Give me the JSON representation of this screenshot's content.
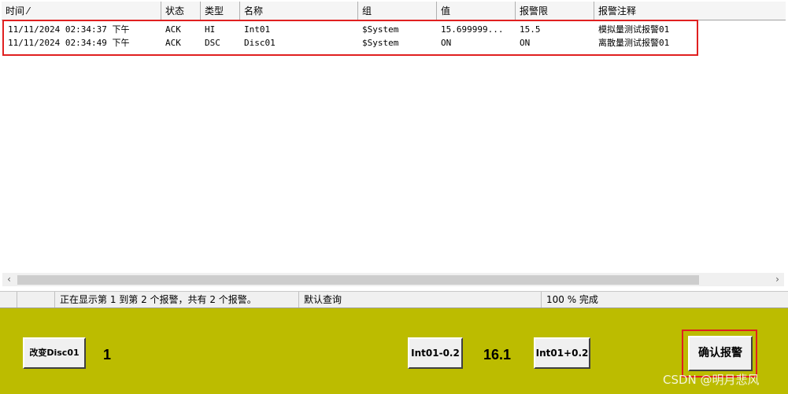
{
  "alarm_grid": {
    "columns": [
      "时间 ⁄",
      "状态",
      "类型",
      "名称",
      "组",
      "值",
      "报警限",
      "报警注释"
    ],
    "rows": [
      {
        "time": "11/11/2024 02:34:37 下午",
        "state": "ACK",
        "type": "HI",
        "name": "Int01",
        "group": "$System",
        "value": "15.699999...",
        "limit": "15.5",
        "comment": "模拟量测试报警01"
      },
      {
        "time": "11/11/2024 02:34:49 下午",
        "state": "ACK",
        "type": "DSC",
        "name": "Disc01",
        "group": "$System",
        "value": "ON",
        "limit": "ON",
        "comment": "离散量测试报警01"
      }
    ]
  },
  "status_bar": {
    "message": "正在显示第 1 到第 2 个报警，共有 2 个报警。",
    "query": "默认查询",
    "progress": "100 % 完成"
  },
  "controls": {
    "change_disc_label": "改变Disc01",
    "disc_value": "1",
    "int_minus_label": "Int01-0.2",
    "int_value": "16.1",
    "int_plus_label": "Int01+0.2",
    "ack_label": "确认报警"
  },
  "watermark": "CSDN @明月悲风",
  "colors": {
    "panel_bg": "#bcbc00",
    "highlight": "#e02020"
  }
}
